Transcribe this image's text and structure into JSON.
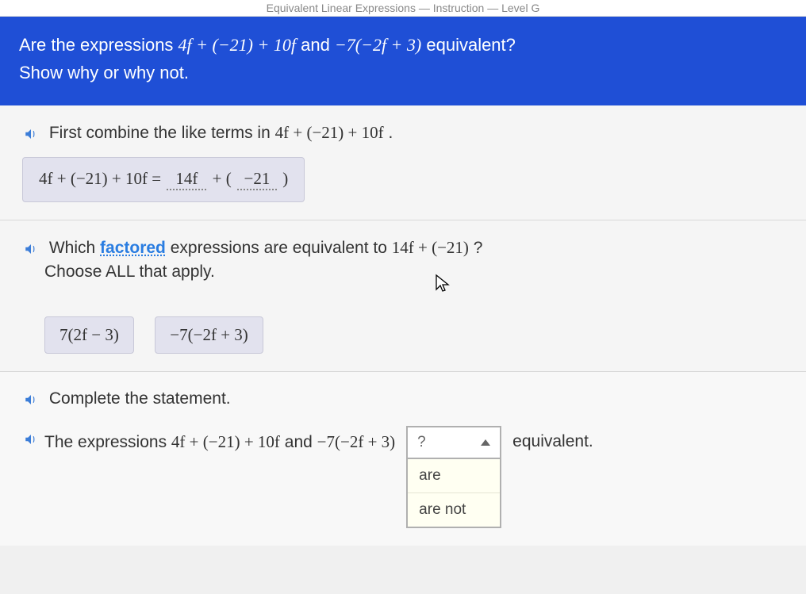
{
  "breadcrumb": "Equivalent Linear Expressions — Instruction — Level G",
  "header": {
    "line1_prefix": "Are the expressions ",
    "expr1": "4f + (−21) + 10f",
    "line1_mid": " and ",
    "expr2": "−7(−2f + 3)",
    "line1_suffix": " equivalent?",
    "line2": "Show why or why not."
  },
  "step1": {
    "prompt_prefix": "First combine the like terms in ",
    "prompt_expr": "4f + (−21) + 10f",
    "prompt_suffix": ".",
    "equation_left": "4f + (−21) + 10f = ",
    "blank1": "14f",
    "plus": " + ( ",
    "blank2": "−21",
    "close": " )"
  },
  "step2": {
    "prompt_a": "Which ",
    "factored_word": "factored",
    "prompt_b": " expressions are equivalent to ",
    "prompt_expr": "14f + (−21)",
    "prompt_c": "?",
    "sub": "Choose ALL that apply.",
    "opt1": "7(2f − 3)",
    "opt2": "−7(−2f + 3)"
  },
  "step3": {
    "prompt": "Complete the statement.",
    "final_a": "The expressions ",
    "final_expr1": "4f + (−21) + 10f",
    "final_mid": " and ",
    "final_expr2": "−7(−2f + 3)",
    "dropdown_placeholder": "?",
    "dropdown_opt1": "are",
    "dropdown_opt2": "are not",
    "final_end": "equivalent."
  }
}
